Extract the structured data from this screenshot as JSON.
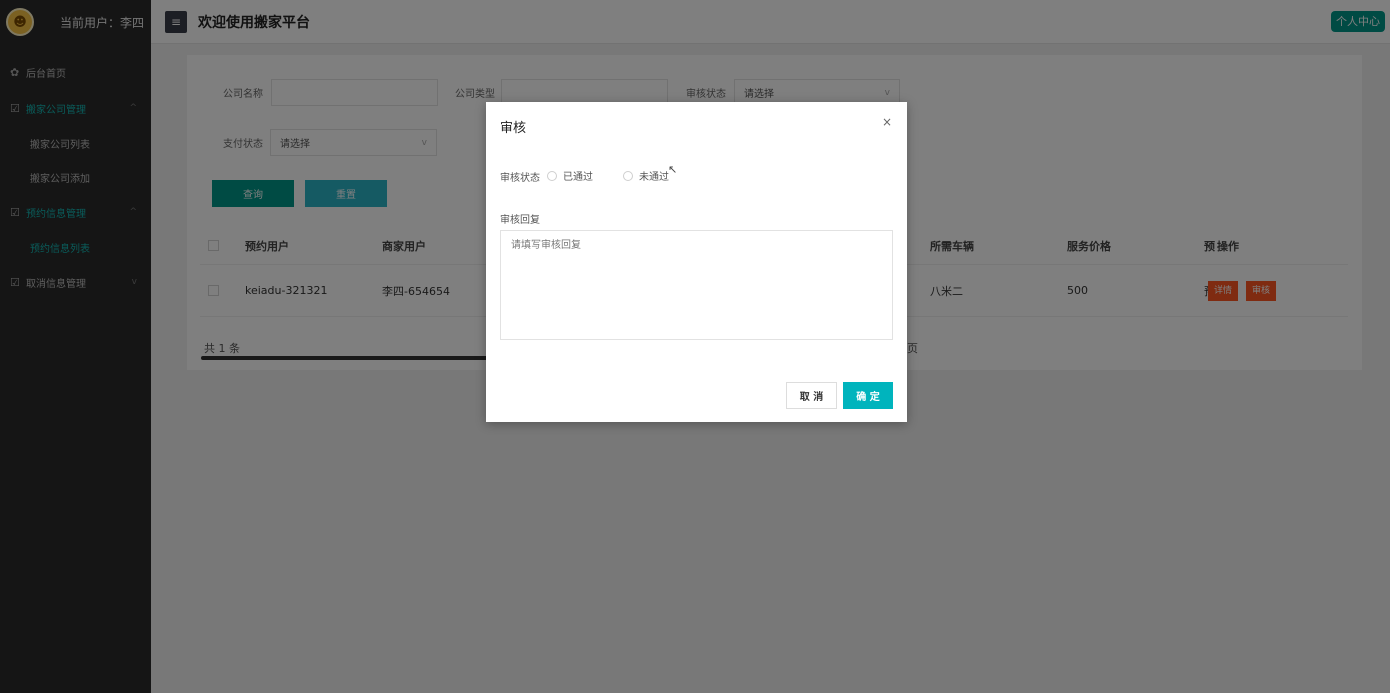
{
  "sidebar": {
    "user_label": "当前用户：李四",
    "items": [
      {
        "label": "后台首页",
        "icon": "home-icon"
      },
      {
        "label": "搬家公司管理",
        "icon": "edit-icon"
      },
      {
        "label": "搬家公司列表"
      },
      {
        "label": "搬家公司添加"
      },
      {
        "label": "预约信息管理",
        "icon": "edit-icon"
      },
      {
        "label": "预约信息列表"
      },
      {
        "label": "取消信息管理",
        "icon": "edit-icon"
      }
    ]
  },
  "header": {
    "title": "欢迎使用搬家平台",
    "personal": "个人中心"
  },
  "filters": {
    "company_name_label": "公司名称",
    "company_type_label": "公司类型",
    "audit_status_label": "审核状态",
    "audit_status_value": "请选择",
    "pay_status_label": "支付状态",
    "pay_status_value": "请选择",
    "query_btn": "查询",
    "reset_btn": "重置"
  },
  "table": {
    "headers": [
      "预约用户",
      "商家用户",
      "所需车辆",
      "服务价格",
      "预",
      "操作"
    ],
    "rows": [
      {
        "user": "keiadu-321321",
        "merchant": "李四-654654",
        "vehicle": "八米二",
        "price": "500",
        "extra": "预"
      }
    ],
    "actions": {
      "detail": "详情",
      "audit": "审核"
    },
    "total": "共 1 条",
    "page_suffix": "页"
  },
  "modal": {
    "title": "审核",
    "close": "×",
    "status_label": "审核状态",
    "options": [
      "已通过",
      "未通过"
    ],
    "reply_label": "审核回复",
    "reply_placeholder": "请填写审核回复",
    "cancel": "取 消",
    "confirm": "确 定"
  },
  "colors": {
    "accent": "#009688",
    "confirm": "#00b4bd",
    "danger": "#ff5722",
    "sidebar": "#2b2b2b"
  }
}
